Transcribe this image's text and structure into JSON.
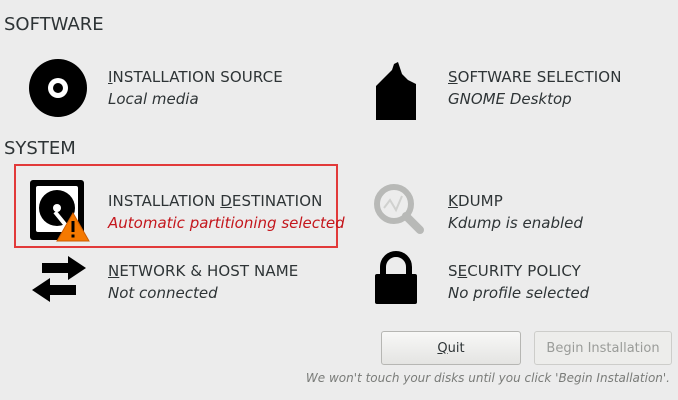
{
  "sections": {
    "software": "SOFTWARE",
    "system": "SYSTEM"
  },
  "spokes": {
    "installation_source": {
      "title_mnemonic": "I",
      "title_rest": "NSTALLATION SOURCE",
      "status": "Local media",
      "icon": "disc-icon"
    },
    "software_selection": {
      "title_mnemonic": "S",
      "title_rest": "OFTWARE SELECTION",
      "status": "GNOME Desktop",
      "icon": "package-icon"
    },
    "installation_destination": {
      "title_before": "INSTALLATION ",
      "title_mnemonic": "D",
      "title_rest": "ESTINATION",
      "status": "Automatic partitioning selected",
      "icon": "hard-disk-icon",
      "warning_icon": "warning-icon"
    },
    "kdump": {
      "title_mnemonic": "K",
      "title_rest": "DUMP",
      "status": "Kdump is enabled",
      "icon": "magnifier-icon"
    },
    "network": {
      "title_mnemonic": "N",
      "title_rest": "ETWORK & HOST NAME",
      "status": "Not connected",
      "icon": "network-arrows-icon"
    },
    "security_policy": {
      "title_before": "S",
      "title_mnemonic": "E",
      "title_rest": "CURITY POLICY",
      "status": "No profile selected",
      "icon": "lock-icon"
    }
  },
  "buttons": {
    "quit_mnemonic": "Q",
    "quit_rest": "uit",
    "begin_installation": "Begin Installation"
  },
  "footer_note": "We won't touch your disks until you click 'Begin Installation'.",
  "colors": {
    "warning": "#c4161c",
    "highlight_border": "#e23a3a",
    "background": "#ececec"
  }
}
